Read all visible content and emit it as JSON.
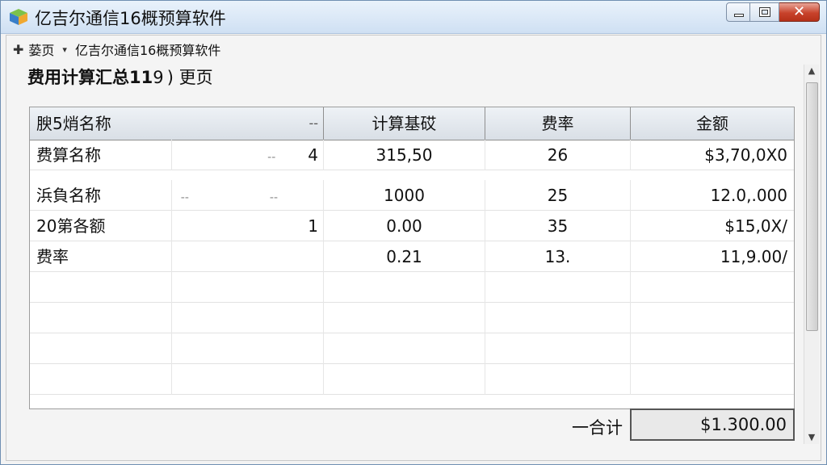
{
  "window": {
    "title": "亿吉尔通信16概预算软件",
    "icon": "app-cube-icon"
  },
  "breadcrumb": {
    "home": "蒆页",
    "current": "亿吉尔通信16概预算软件"
  },
  "heading": {
    "title": "费用计算汇总11",
    "suffix": "9 ) 更页"
  },
  "table": {
    "headers": [
      "腴5焇名称",
      "--",
      "计算基砹",
      "费率",
      "金额"
    ],
    "rows": [
      {
        "name": "费算名称",
        "qty": "4",
        "base": "315,50",
        "rate": "26",
        "amount": "$3,70,0X0",
        "extra": "--"
      },
      {
        "name": "浜負名称",
        "qty": "--",
        "base": "1000",
        "rate": "25",
        "amount": "12.0,.000",
        "extra": "--"
      },
      {
        "name": "20第各额",
        "qty": "1",
        "base": "0.00",
        "rate": "35",
        "amount": "$15,0X/",
        "extra": ""
      },
      {
        "name": "费率",
        "qty": "",
        "base": "0.21",
        "rate": "13.",
        "amount": "11,9.00/",
        "extra": ""
      }
    ]
  },
  "total": {
    "label": "一合计",
    "value": "$1.300.00"
  }
}
